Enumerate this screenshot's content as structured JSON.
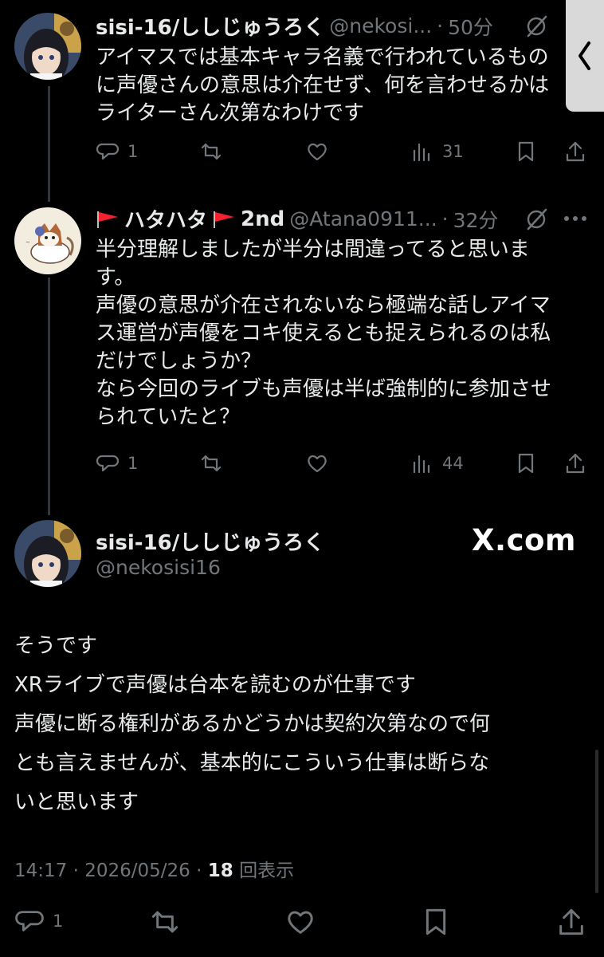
{
  "tweets": [
    {
      "name": "sisi-16/ししじゅうろく",
      "handle": "@nekosi...",
      "time": "50分",
      "lines": [
        "アイマスでは基本キャラ名義で行われているもの",
        "に声優さんの意思は介在せず、何を言わせるかは",
        "ライターさん次第なわけです"
      ],
      "stats": {
        "replies": "1",
        "views": "31"
      }
    },
    {
      "name": "ハタハタ",
      "name_suffix": "2nd",
      "handle": "@Atana0911...",
      "time": "32分",
      "lines": [
        "半分理解しましたが半分は間違ってると思いま",
        "す。",
        "声優の意思が介在されないなら極端な話しアイマ",
        "ス運営が声優をコキ使えるとも捉えられるのは私",
        "だけでしょうか？",
        "なら今回のライブも声優は半ば強制的に参加させ",
        "られていたと？"
      ],
      "stats": {
        "replies": "1",
        "views": "44"
      }
    }
  ],
  "main_tweet": {
    "name": "sisi-16/ししじゅうろく",
    "handle": "@nekosisi16",
    "brand": "X.com",
    "lines": [
      "そうです",
      "XRライブで声優は台本を読むのが仕事です",
      "声優に断る権利があるかどうかは契約次第なので何",
      "とも言えませんが、基本的にこういう仕事は断らな",
      "いと思います"
    ],
    "time": "14:17",
    "date": "2026/05/26",
    "views": "18",
    "views_label": "回表示",
    "replies": "1"
  },
  "icons": {
    "reply": "reply-icon",
    "retweet": "retweet-icon",
    "like": "heart-icon",
    "views": "analytics-icon",
    "bookmark": "bookmark-icon",
    "share": "share-icon",
    "grok": "grok-icon",
    "more": "more-icon",
    "back": "chevron-left-icon"
  },
  "colors": {
    "background": "#000000",
    "text": "#e7e9ea",
    "muted": "#71767b",
    "flag": "#f4212e"
  }
}
